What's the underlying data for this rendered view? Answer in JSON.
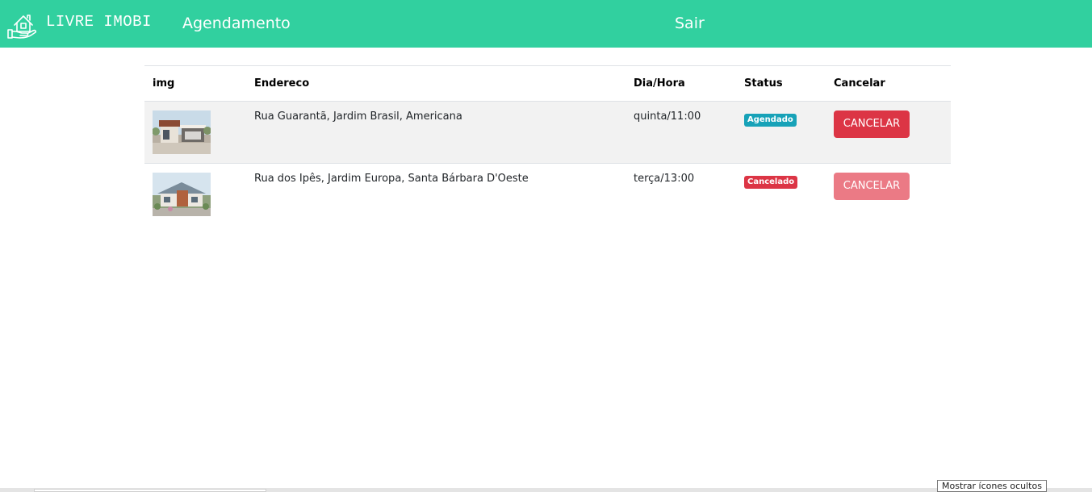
{
  "navbar": {
    "brand": "LIVRE IMOBI",
    "logo_icon": "house-in-hand-icon",
    "links": [
      {
        "label": "Agendamento"
      },
      {
        "label": "Sair"
      }
    ],
    "background": "#31d09f"
  },
  "table": {
    "headers": [
      "img",
      "Endereco",
      "Dia/Hora",
      "Status",
      "Cancelar"
    ],
    "rows": [
      {
        "image": "modern-house-photo",
        "endereco": "Rua Guarantã, Jardim Brasil, Americana",
        "dia_hora": "quinta/11:00",
        "status": "Agendado",
        "status_color": "#17a2b8",
        "button": "CANCELAR",
        "button_color": "#dc3545",
        "button_enabled": true
      },
      {
        "image": "single-story-house-photo",
        "endereco": "Rua dos Ipês, Jardim Europa, Santa Bárbara D'Oeste",
        "dia_hora": "terça/13:00",
        "status": "Cancelado",
        "status_color": "#dc3545",
        "button": "CANCELAR",
        "button_color": "#eb7a85",
        "button_enabled": false
      }
    ]
  },
  "tooltip": "Mostrar ícones ocultos"
}
